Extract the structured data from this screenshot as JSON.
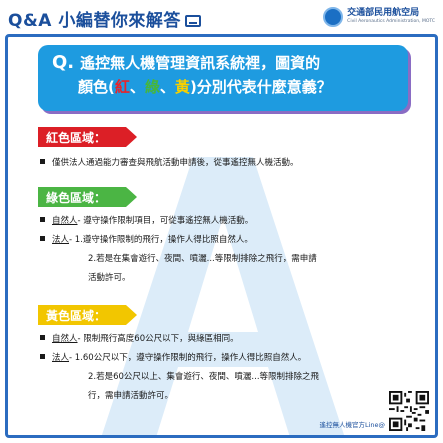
{
  "header": {
    "title": "Q&A 小編替你來解答",
    "brand_name": "交通部民用航空局",
    "brand_sub": "Civil Aeronautics Administration, MOTC"
  },
  "question": {
    "mark": "Q.",
    "line1": "遙控無人機管理資訊系統裡，圖資的",
    "line2_prefix": "顏色(",
    "red": "紅",
    "sep1": "、",
    "green": "綠",
    "sep2": "、",
    "yellow": "黃",
    "line2_suffix": ")分別代表什麼意義？"
  },
  "sections": {
    "red": {
      "label": "紅色區域：",
      "items": [
        "僅供法人通過能力審查與飛航活動申請後，從事遙控無人機活動。"
      ]
    },
    "green": {
      "label": "綠色區域：",
      "item1_who": "自然人",
      "item1_text": "- 遵守操作限制項目，可從事遙控無人機活動。",
      "item2_who": "法人",
      "item2_text": "- 1.遵守操作限制的飛行，操作人得比照自然人。",
      "item2_cont1": "2.若是在集會遊行、夜間、噴灑...等限制排除之飛行，需申請",
      "item2_cont2": "活動許可。"
    },
    "yellow": {
      "label": "黃色區域：",
      "item1_who": "自然人",
      "item1_text": "- 限制飛行高度60公尺以下，與綠區相同。",
      "item2_who": "法人",
      "item2_text": "- 1.60公尺以下，遵守操作限制的飛行，操作人得比照自然人。",
      "item2_cont1": "2.若是60公尺以上、集會遊行、夜間、噴灑...等限制排除之飛",
      "item2_cont2": "行，需申請活動許可。"
    }
  },
  "footer": {
    "text": "遙控無人機官方Line@"
  },
  "colors": {
    "brand_blue": "#1b4f9c",
    "question_bg": "#1e9be0",
    "red": "#dc1f26",
    "green": "#4bb544",
    "yellow": "#f2c600"
  },
  "icons": {
    "header": "chat-bubble-icon",
    "brand": "caa-logo",
    "footer": "qr-code"
  }
}
